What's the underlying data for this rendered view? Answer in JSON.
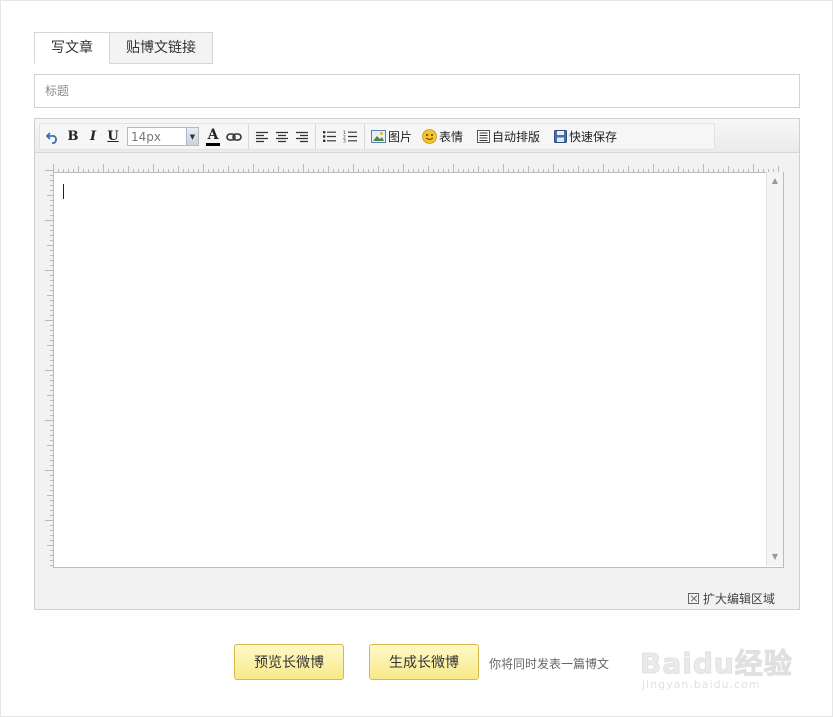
{
  "tabs": [
    {
      "label": "写文章",
      "active": true
    },
    {
      "label": "贴博文链接",
      "active": false
    }
  ],
  "title_input": {
    "placeholder": "标题",
    "value": ""
  },
  "toolbar": {
    "undo_icon": "undo-icon",
    "bold_label": "B",
    "italic_label": "I",
    "underline_label": "U",
    "font_size": "14px",
    "font_color_label": "A",
    "font_color": "#000000",
    "link_icon": "link-icon",
    "align_icons": [
      "align-left-icon",
      "align-center-icon",
      "align-right-icon"
    ],
    "list_icons": [
      "bullet-list-icon",
      "numbered-list-icon"
    ],
    "image_label": "图片",
    "emoji_label": "表情",
    "autoformat_label": "自动排版",
    "quicksave_label": "快速保存"
  },
  "editor": {
    "content": "",
    "expand_label": "扩大编辑区域"
  },
  "actions": {
    "preview_label": "预览长微博",
    "generate_label": "生成长微博",
    "note": "你将同时发表一篇博文"
  },
  "watermark": {
    "main": "Baidu经验",
    "sub": "jingyan.baidu.com"
  },
  "colors": {
    "button_bg": "#f8e98a",
    "button_border": "#d9b84a",
    "accent_blue": "#5a7fb8"
  }
}
